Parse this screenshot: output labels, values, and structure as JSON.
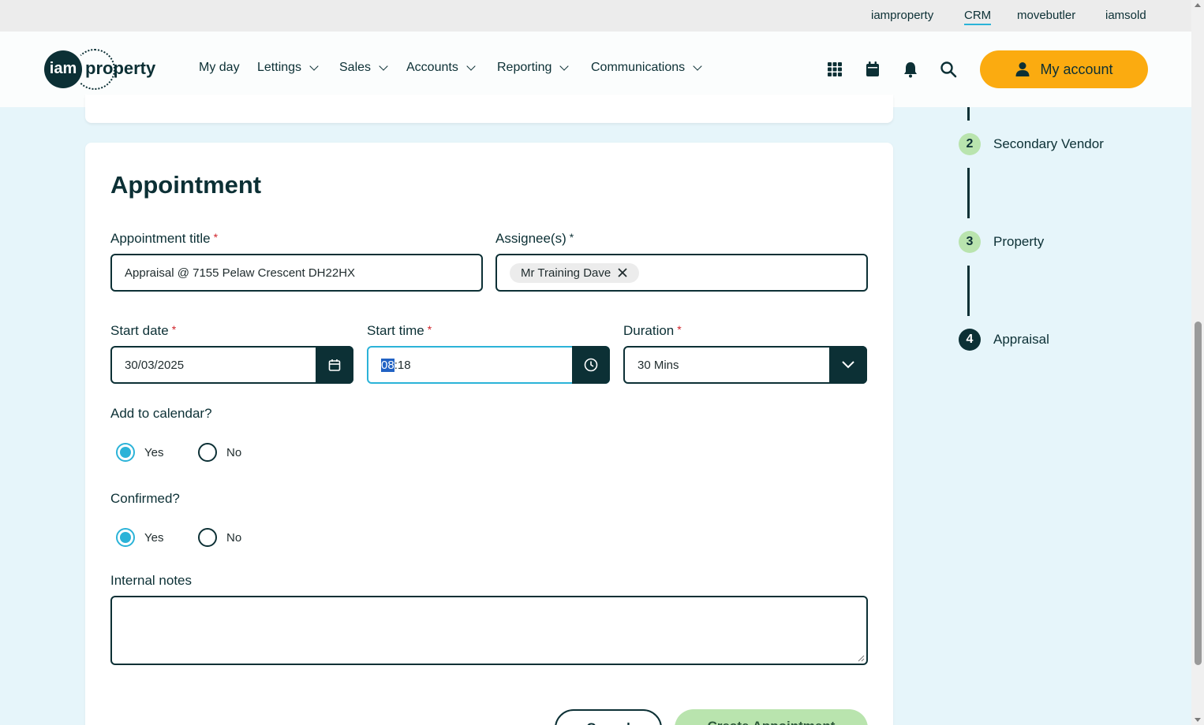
{
  "top_links": [
    "iamproperty",
    "CRM",
    "movebutler",
    "iamsold"
  ],
  "logo": {
    "mark": "iam",
    "word": "property"
  },
  "nav": [
    "My day",
    "Lettings",
    "Sales",
    "Accounts",
    "Reporting",
    "Communications"
  ],
  "header_icons": [
    "apps-grid-icon",
    "calendar-icon",
    "bell-icon",
    "search-icon"
  ],
  "account_label": "My account",
  "form": {
    "heading": "Appointment",
    "title_label": "Appointment title",
    "title_value": "Appraisal @ 7155 Pelaw Crescent  DH22HX",
    "assignee_label": "Assignee(s)",
    "assignee_chip": "Mr Training Dave",
    "start_date_label": "Start date",
    "start_date_value": "30/03/2025",
    "start_time_label": "Start time",
    "start_time_hours": "08",
    "start_time_rest": ":18",
    "duration_label": "Duration",
    "duration_value": "30 Mins",
    "calendar_label": "Add to calendar?",
    "calendar_selected": "Yes",
    "confirmed_label": "Confirmed?",
    "confirmed_selected": "Yes",
    "yes": "Yes",
    "no": "No",
    "notes_label": "Internal notes",
    "notes_value": "",
    "required_mark": "*",
    "cancel_label": "Cancel",
    "create_label": "Create Appointment"
  },
  "steps": [
    {
      "num": "2",
      "label": "Secondary Vendor",
      "status": "done"
    },
    {
      "num": "3",
      "label": "Property",
      "status": "done"
    },
    {
      "num": "4",
      "label": "Appraisal",
      "status": "current"
    }
  ],
  "colors": {
    "brand": "#0c3035",
    "accent": "#fbab10",
    "focus": "#2bb3d8",
    "step_done": "#b9e4ae",
    "background": "#e6f5fa"
  }
}
